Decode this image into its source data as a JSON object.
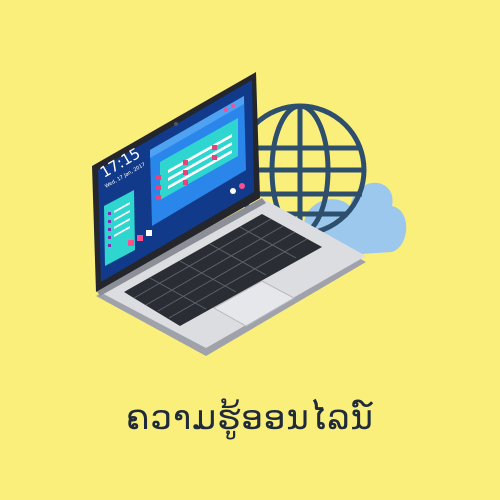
{
  "caption": "ຄວາມຮູ້ອອນໄລນ໌",
  "screen": {
    "clock_time": "17:15",
    "clock_date": "Wed, 17 Jan, 2017"
  },
  "icons": [
    "laptop-icon",
    "globe-icon",
    "cloud-icon"
  ],
  "colors": {
    "background": "#fbef7c",
    "laptop_body": "#d9d9dc",
    "screen_bg": "#123a8a",
    "window": "#2a86ea",
    "panel": "#2fd6d0",
    "globe": "#2d4f6d",
    "cloud": "#9dc8ee"
  }
}
